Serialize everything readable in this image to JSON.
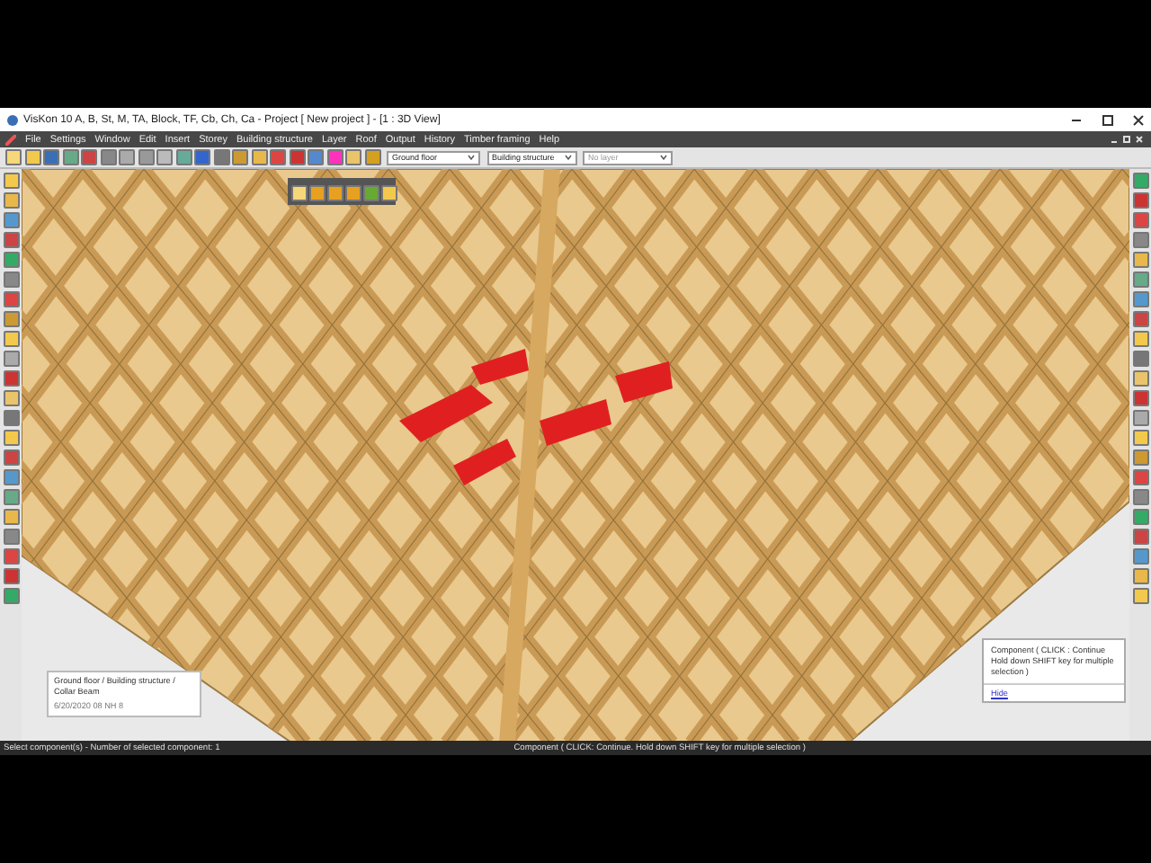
{
  "window": {
    "title": "VisKon 10 A, B, St, M, TA, Block, TF, Cb, Ch, Ca - Project [ New project ] - [1 : 3D View]"
  },
  "menu": [
    "File",
    "Settings",
    "Window",
    "Edit",
    "Insert",
    "Storey",
    "Building structure",
    "Layer",
    "Roof",
    "Output",
    "History",
    "Timber framing",
    "Help"
  ],
  "toolbar": {
    "storey": "Ground floor",
    "structure": "Building structure",
    "layer": "No layer"
  },
  "info_box": {
    "path": "Ground floor / Building structure / Collar Beam",
    "date": "6/20/2020 08 NH 8"
  },
  "tooltip": {
    "text": "Component ( CLICK : Continue Hold down SHIFT key for multiple selection )",
    "link": "Hide"
  },
  "status_bar": {
    "left": "Select component(s) - Number of selected component: 1",
    "right": "Component ( CLICK: Continue. Hold down SHIFT key for multiple selection )"
  }
}
